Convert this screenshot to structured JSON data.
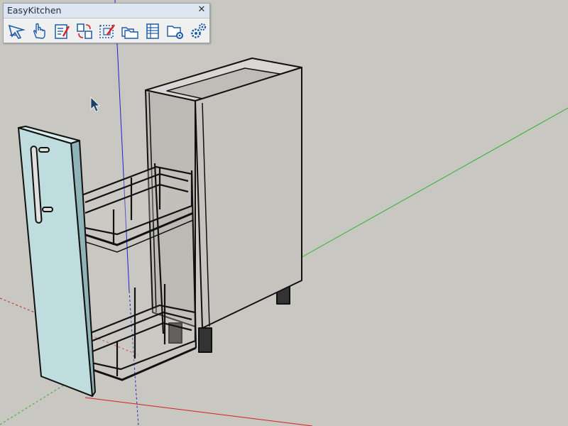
{
  "toolbar": {
    "title": "EasyKitchen",
    "close_glyph": "✕",
    "buttons": [
      {
        "icon": "select-arrow-icon"
      },
      {
        "icon": "hand-pan-icon"
      },
      {
        "icon": "edit-form-icon"
      },
      {
        "icon": "swap-components-icon"
      },
      {
        "icon": "edit-selection-icon"
      },
      {
        "icon": "folders-icon"
      },
      {
        "icon": "cut-list-table-icon"
      },
      {
        "icon": "folder-settings-icon"
      },
      {
        "icon": "settings-gears-icon"
      }
    ]
  },
  "colors": {
    "background": "#c9c7c1",
    "axis_red": "#d12020",
    "axis_green": "#2bb52b",
    "axis_blue": "#2222cc",
    "cabinet_side": "#c7c4bf",
    "door_face": "#bfdcdf",
    "icon_blue": "#1a5aa8"
  }
}
